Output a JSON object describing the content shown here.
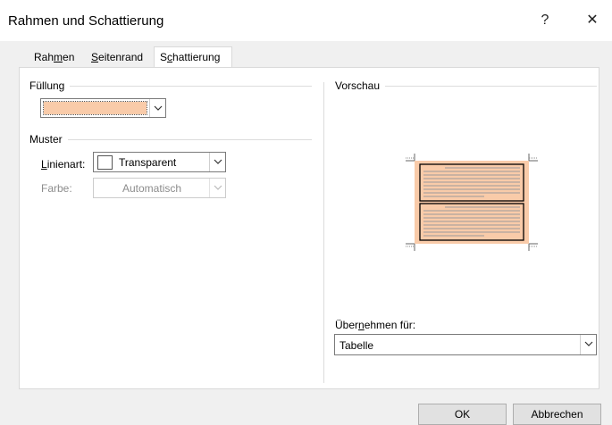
{
  "window": {
    "title": "Rahmen und Schattierung",
    "help_glyph": "?",
    "close_glyph": "✕"
  },
  "tabs": [
    {
      "pre": "Rah",
      "ul": "m",
      "post": "en"
    },
    {
      "pre": "",
      "ul": "S",
      "post": "eitenrand"
    },
    {
      "pre": "S",
      "ul": "c",
      "post": "hattierung"
    }
  ],
  "fill": {
    "label": "Füllung",
    "color": "#f9cba9"
  },
  "pattern": {
    "label": "Muster",
    "style_label_ul": "L",
    "style_label_rest": "inienart:",
    "style_value": "Transparent",
    "color_label": "Farbe:",
    "color_value": "Automatisch"
  },
  "preview": {
    "label": "Vorschau",
    "shade_color": "#f9cba9"
  },
  "apply": {
    "label_pre": "Über",
    "label_ul": "n",
    "label_post": "ehmen für:",
    "value": "Tabelle"
  },
  "buttons": {
    "ok": "OK",
    "cancel": "Abbrechen"
  }
}
